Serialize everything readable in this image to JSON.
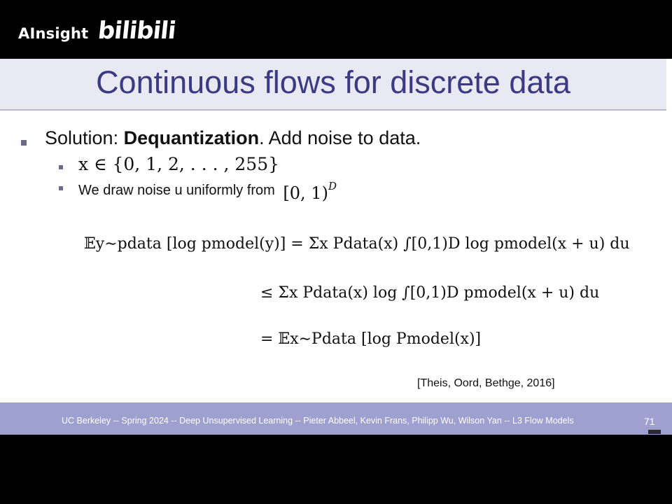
{
  "watermark": {
    "brand": "AInsight",
    "logo": "bilibili"
  },
  "slide": {
    "title": "Continuous flows for discrete data",
    "bullet1": {
      "prefix": "Solution: ",
      "bold": "Dequantization",
      "suffix": ". Add noise to data."
    },
    "bullet2": "x ∈ {0, 1, 2, . . . , 255}",
    "bullet3": {
      "text": "We draw noise u uniformly from",
      "math": "[0, 1)",
      "sup": "D"
    },
    "equations": [
      "𝔼y∼pdata [log pmodel(y)] = Σx Pdata(x) ∫[0,1)D log pmodel(x + u) du",
      "≤ Σx Pdata(x) log ∫[0,1)D pmodel(x + u) du",
      "= 𝔼x∼Pdata [log Pmodel(x)]"
    ],
    "citation": "[Theis, Oord, Bethge, 2016]"
  },
  "footer": {
    "text": "UC Berkeley -- Spring 2024 -- Deep Unsupervised Learning -- Pieter Abbeel, Kevin Frans, Philipp Wu, Wilson Yan -- L3 Flow Models",
    "page": "71"
  }
}
